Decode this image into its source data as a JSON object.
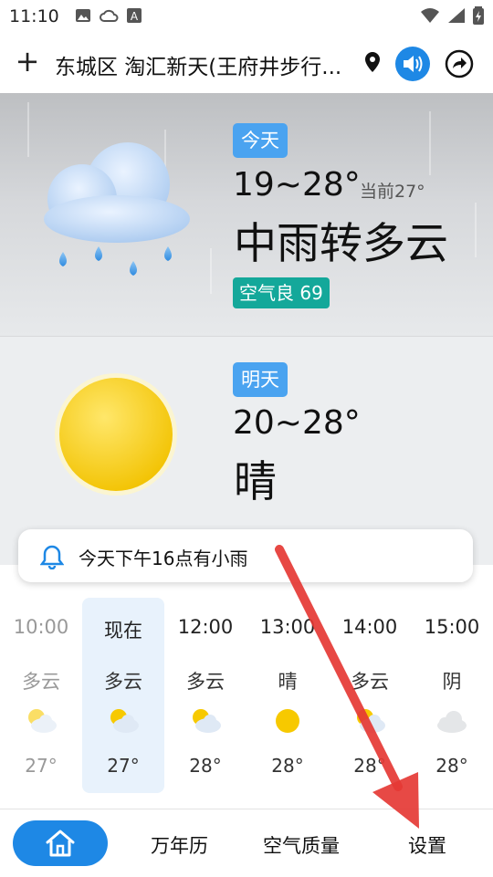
{
  "status_bar": {
    "time": "11:10"
  },
  "header": {
    "location": "东城区 淘汇新天(王府井步行..."
  },
  "today": {
    "badge": "今天",
    "temp_range": "19~28°",
    "current_temp": "当前27°",
    "condition": "中雨转多云",
    "aqi": "空气良 69"
  },
  "tomorrow": {
    "badge": "明天",
    "temp_range": "20~28°",
    "condition": "晴"
  },
  "alert": {
    "text": "今天下午16点有小雨"
  },
  "hourly": [
    {
      "time": "10:00",
      "condition": "多云",
      "temp": "27°",
      "icon": "partly-cloudy-icon"
    },
    {
      "time": "现在",
      "condition": "多云",
      "temp": "27°",
      "icon": "partly-cloudy-icon"
    },
    {
      "time": "12:00",
      "condition": "多云",
      "temp": "28°",
      "icon": "partly-cloudy-icon"
    },
    {
      "time": "13:00",
      "condition": "晴",
      "temp": "28°",
      "icon": "sun-icon"
    },
    {
      "time": "14:00",
      "condition": "多云",
      "temp": "28°",
      "icon": "partly-cloudy-icon"
    },
    {
      "time": "15:00",
      "condition": "阴",
      "temp": "28°",
      "icon": "cloud-icon"
    }
  ],
  "nav": {
    "calendar": "万年历",
    "air_quality": "空气质量",
    "settings": "设置"
  },
  "colors": {
    "accent": "#1e88e5",
    "badge_blue": "#4aa3f0",
    "aqi_green": "#14a89a",
    "arrow_red": "#e53935"
  }
}
